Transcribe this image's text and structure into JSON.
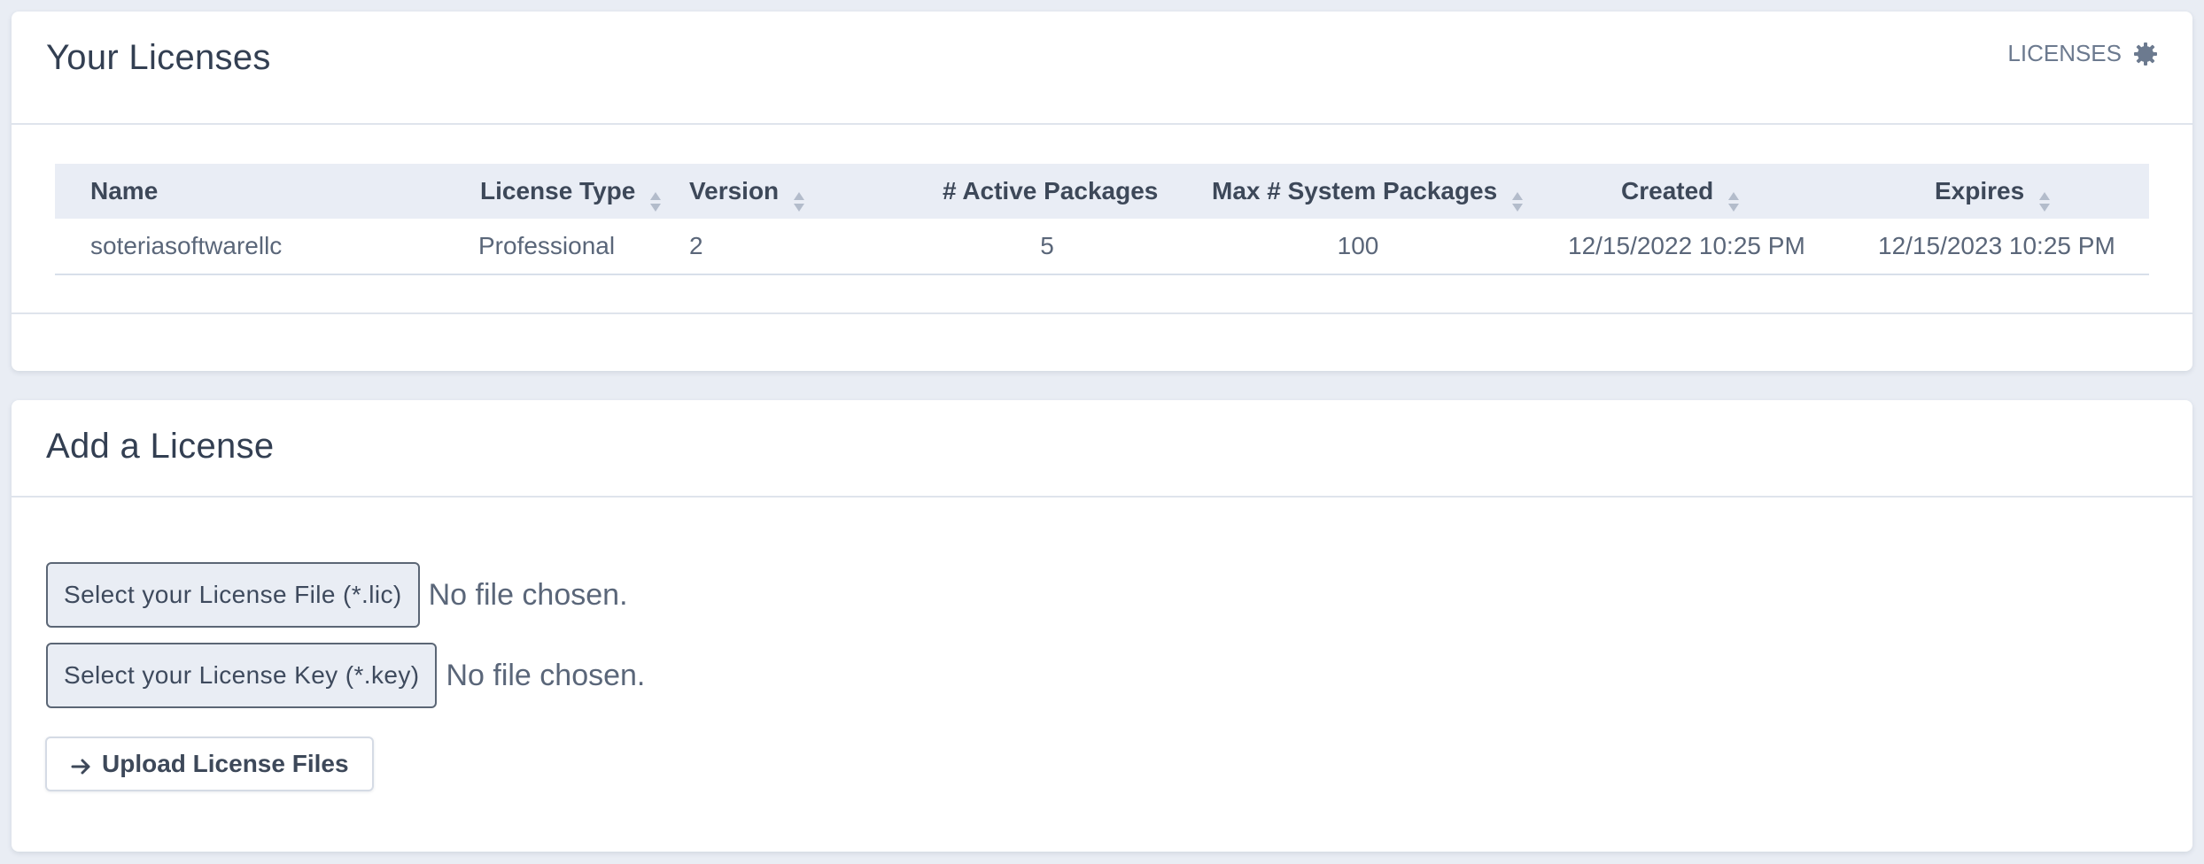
{
  "licenses_card": {
    "title": "Your Licenses",
    "header_link": "LICENSES",
    "header_icon": "gear-icon",
    "table": {
      "columns": [
        {
          "label": "Name",
          "sortable": false
        },
        {
          "label": "License Type",
          "sortable": true
        },
        {
          "label": "Version",
          "sortable": true
        },
        {
          "label": "# Active Packages",
          "sortable": false
        },
        {
          "label": "Max # System Packages",
          "sortable": true
        },
        {
          "label": "Created",
          "sortable": true
        },
        {
          "label": "Expires",
          "sortable": true
        }
      ],
      "rows": [
        {
          "name": "soteriasoftwarellc",
          "license_type": "Professional",
          "version": "2",
          "active_packages": "5",
          "max_system_packages": "100",
          "created": "12/15/2022 10:25 PM",
          "expires": "12/15/2023 10:25 PM"
        }
      ]
    }
  },
  "add_card": {
    "title": "Add a License",
    "license_file_button": "Select your License File (*.lic)",
    "license_file_status": "No file chosen.",
    "license_key_button": "Select your License Key (*.key)",
    "license_key_status": "No file chosen.",
    "upload_button": "Upload License Files",
    "upload_icon": "arrow-right-icon"
  },
  "colors": {
    "page_background": "#e9edf4",
    "card_background": "#ffffff",
    "table_header_background": "#e9edf5",
    "text_primary": "#333f52",
    "text_muted": "#5a6679"
  }
}
